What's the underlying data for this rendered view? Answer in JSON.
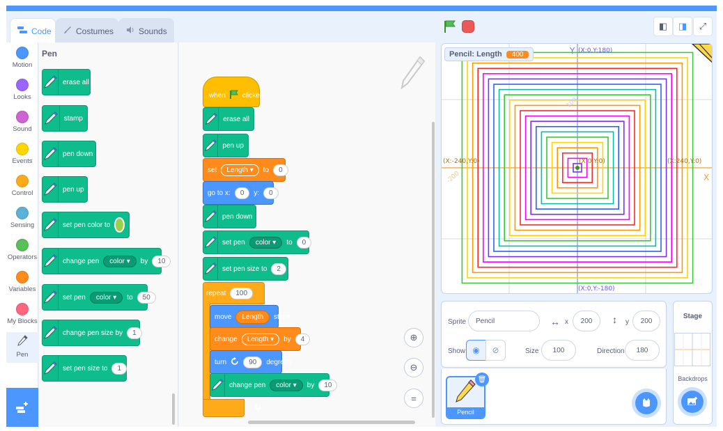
{
  "tabs": [
    {
      "label": "Code",
      "icon": "code-icon"
    },
    {
      "label": "Costumes",
      "icon": "brush-icon"
    },
    {
      "label": "Sounds",
      "icon": "speaker-icon"
    }
  ],
  "categories": [
    {
      "label": "Motion",
      "color": "#4c97ff"
    },
    {
      "label": "Looks",
      "color": "#9966ff"
    },
    {
      "label": "Sound",
      "color": "#cf63cf"
    },
    {
      "label": "Events",
      "color": "#ffd500"
    },
    {
      "label": "Control",
      "color": "#ffab19"
    },
    {
      "label": "Sensing",
      "color": "#5cb1d6"
    },
    {
      "label": "Operators",
      "color": "#59c059"
    },
    {
      "label": "Variables",
      "color": "#ff8c1a"
    },
    {
      "label": "My Blocks",
      "color": "#ff6680"
    },
    {
      "label": "Pen",
      "color": "#0fbd8c"
    }
  ],
  "palette": {
    "title": "Pen",
    "erase_all": "erase all",
    "stamp": "stamp",
    "pen_down": "pen down",
    "pen_up": "pen up",
    "set_pen_color_to": "set pen color to",
    "change_pen": "change pen",
    "color_opt": "color",
    "by": "by",
    "change_value": "10",
    "set_pen": "set pen",
    "to": "to",
    "set_value": "50",
    "change_pen_size_by": "change pen size by",
    "change_size_value": "1",
    "set_pen_size_to": "set pen size to",
    "set_size_value": "1"
  },
  "script": {
    "when": "when",
    "clicked": "clicked",
    "erase_all": "erase all",
    "pen_up": "pen up",
    "set": "set",
    "length_var": "Length",
    "to": "to",
    "set_length_value": "0",
    "go_to_x": "go to x:",
    "x_value": "0",
    "y_label": "y:",
    "y_value": "0",
    "pen_down": "pen down",
    "set_pen": "set pen",
    "color_opt": "color",
    "set_color_value": "0",
    "set_pen_size_to": "set pen size to",
    "pen_size_value": "2",
    "repeat": "repeat",
    "repeat_value": "100",
    "move": "move",
    "steps": "steps",
    "change": "change",
    "by": "by",
    "change_length_value": "4",
    "turn": "turn",
    "turn_value": "90",
    "degrees": "degrees",
    "change_pen": "change pen",
    "change_pen_value": "10",
    "loop_arrow": "↻"
  },
  "stage": {
    "monitor_label": "Pencil: Length",
    "monitor_value": "400",
    "top_coord": "(X:0,Y:180)",
    "bottom_coord": "(X:0,Y:-180)",
    "left_coord": "(X:-240,Y:0)",
    "right_coord": "(X:240,Y:0)",
    "center_coord": "(X:0,Y:0)",
    "x_axis": "X",
    "y_axis": "Y",
    "tick_neg200": "-200",
    "tick_100": "100"
  },
  "sprite_info": {
    "sprite_label": "Sprite",
    "sprite_name": "Pencil",
    "x_label": "x",
    "x_value": "200",
    "y_label": "y",
    "y_value": "200",
    "show_label": "Show",
    "size_label": "Size",
    "size_value": "100",
    "direction_label": "Direction",
    "direction_value": "180"
  },
  "sprite_list": {
    "thumb_name": "Pencil"
  },
  "stage_panel": {
    "title": "Stage",
    "backdrops": "Backdrops"
  },
  "square_colors": [
    "#7b2ff7",
    "#ff00ff",
    "#ff2a2a",
    "#ff9900",
    "#ffd400",
    "#33cc33",
    "#00bfa5",
    "#2962ff"
  ]
}
